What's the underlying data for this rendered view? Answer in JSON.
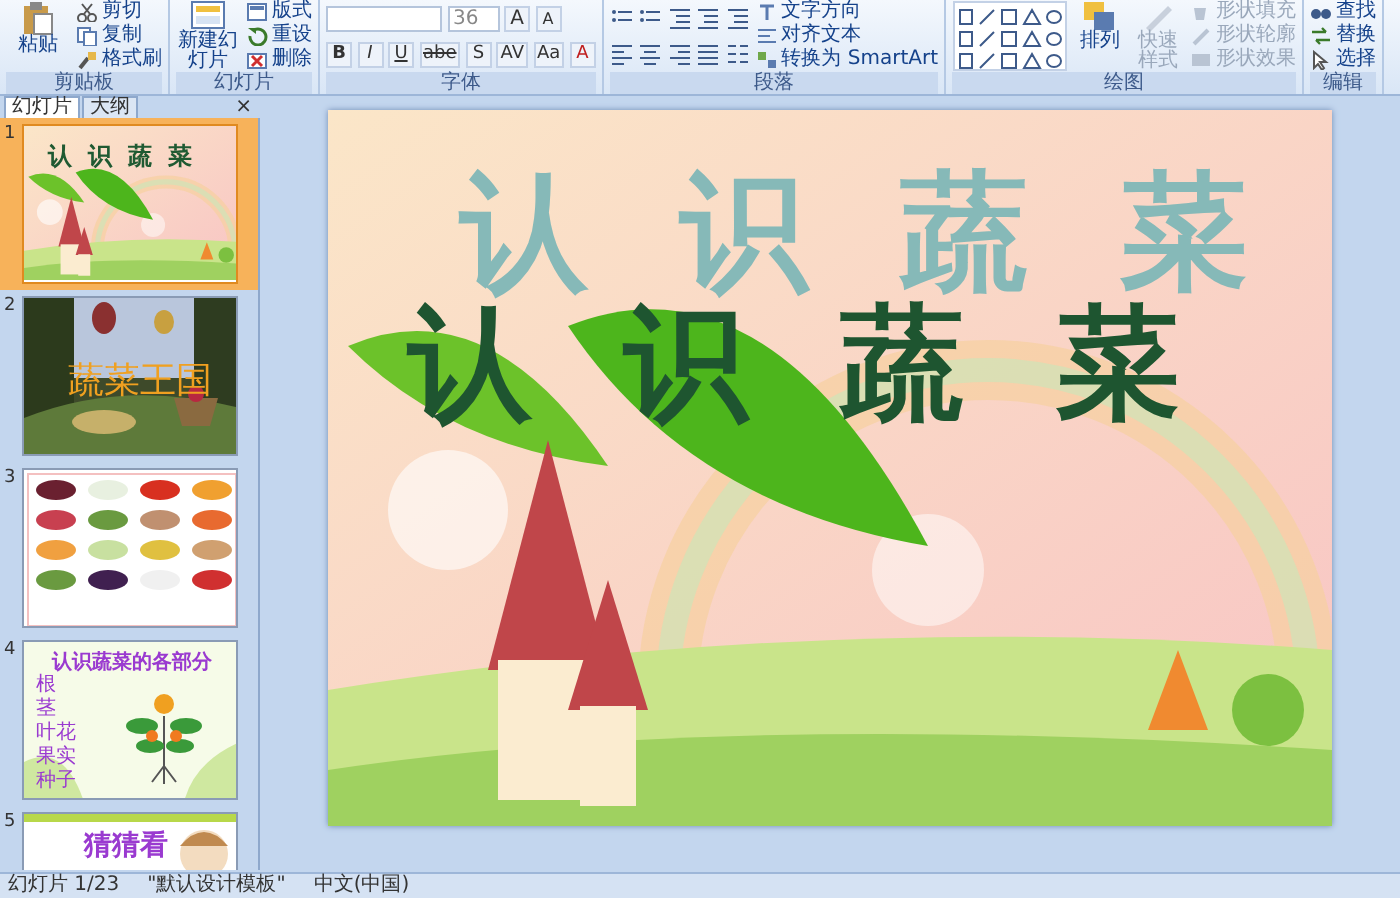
{
  "ribbon": {
    "groups": [
      {
        "kind": "buttons",
        "label": "剪贴板",
        "large": [
          {
            "label": "粘贴",
            "disabled": false
          }
        ],
        "small": [
          {
            "label": "剪切",
            "disabled": false
          },
          {
            "label": "复制",
            "disabled": false
          },
          {
            "label": "格式刷",
            "disabled": false
          }
        ]
      },
      {
        "kind": "buttons",
        "label": "幻灯片",
        "large": [
          {
            "label": "新建幻灯片",
            "disabled": false
          }
        ],
        "small": [
          {
            "label": "版式",
            "disabled": false
          },
          {
            "label": "重设",
            "disabled": false
          },
          {
            "label": "删除",
            "disabled": false
          }
        ]
      },
      {
        "kind": "font",
        "label": "字体",
        "font_size": "36",
        "grow_buttons": [
          "A",
          "A"
        ],
        "format_buttons": [
          "B",
          "I",
          "U",
          "abe",
          "S",
          "AV",
          "Aa",
          "A"
        ]
      },
      {
        "kind": "paragraph",
        "label": "段落",
        "small": [
          {
            "label": "文字方向",
            "disabled": false
          },
          {
            "label": "对齐文本",
            "disabled": false
          },
          {
            "label": "转换为 SmartArt",
            "disabled": false
          }
        ]
      },
      {
        "kind": "drawing",
        "label": "绘图",
        "large": [
          {
            "label": "排列",
            "disabled": false
          },
          {
            "label": "快速样式",
            "disabled": true
          }
        ],
        "small": [
          {
            "label": "形状填充",
            "disabled": true
          },
          {
            "label": "形状轮廓",
            "disabled": true
          },
          {
            "label": "形状效果",
            "disabled": true
          }
        ]
      },
      {
        "kind": "buttons",
        "label": "编辑",
        "small": [
          {
            "label": "查找",
            "disabled": false
          },
          {
            "label": "替换",
            "disabled": false
          },
          {
            "label": "选择",
            "disabled": false
          }
        ]
      }
    ]
  },
  "panel": {
    "tabs": [
      {
        "label": "幻灯片",
        "selected": true
      },
      {
        "label": "大纲",
        "selected": false
      }
    ],
    "close": "×",
    "slides": [
      {
        "number": "1",
        "selected": true,
        "kind": "title",
        "title": "认识蔬菜"
      },
      {
        "number": "2",
        "selected": false,
        "kind": "photo_title",
        "title": "蔬菜王国"
      },
      {
        "number": "3",
        "selected": false
      },
      {
        "number": "4",
        "selected": false,
        "kind": "diagram",
        "title": "认识蔬菜的各部分",
        "labels": [
          "根",
          "茎",
          "叶花",
          "果实",
          "种子"
        ]
      },
      {
        "number": "5",
        "selected": false,
        "kind": "partial",
        "title": "猜猜看"
      }
    ]
  },
  "slide": {
    "title": "认识蔬菜",
    "title_echo": "认识蔬菜"
  },
  "status_bar": [
    "幻灯片 1/23",
    "\"默认设计模板\"",
    "中文(中国)"
  ]
}
